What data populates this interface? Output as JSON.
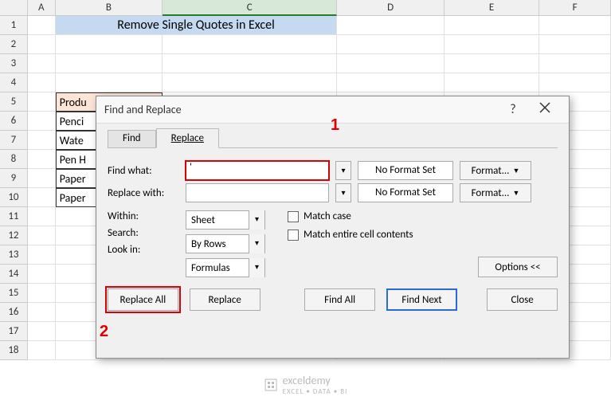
{
  "columns": [
    "A",
    "B",
    "C",
    "D",
    "E",
    "F"
  ],
  "rows": [
    "1",
    "2",
    "3",
    "4",
    "5",
    "6",
    "7",
    "8",
    "9",
    "10",
    "11",
    "12",
    "13",
    "14",
    "15",
    "16",
    "17",
    "18"
  ],
  "title_cell": "Remove Single Quotes in Excel",
  "table": {
    "header": "Produ",
    "rows": [
      "Penci",
      "Wate",
      "Pen H",
      "Paper",
      "Paper"
    ]
  },
  "dialog": {
    "title": "Find and Replace",
    "tabs": {
      "find": "Find",
      "replace": "Replace"
    },
    "labels": {
      "find_what": "Find what:",
      "replace_with": "Replace with:",
      "within": "Within:",
      "search": "Search:",
      "look_in": "Look in:"
    },
    "find_value": "'",
    "replace_value": "",
    "no_format": "No Format Set",
    "format_btn": "Format...",
    "within_val": "Sheet",
    "search_val": "By Rows",
    "lookin_val": "Formulas",
    "match_case": "Match case",
    "match_entire": "Match entire cell contents",
    "options_btn": "Options <<",
    "buttons": {
      "replace_all": "Replace All",
      "replace": "Replace",
      "find_all": "Find All",
      "find_next": "Find Next",
      "close": "Close"
    }
  },
  "annotations": {
    "one": "1",
    "two": "2"
  },
  "watermark": {
    "main": "exceldemy",
    "sub": "EXCEL • DATA • BI"
  }
}
